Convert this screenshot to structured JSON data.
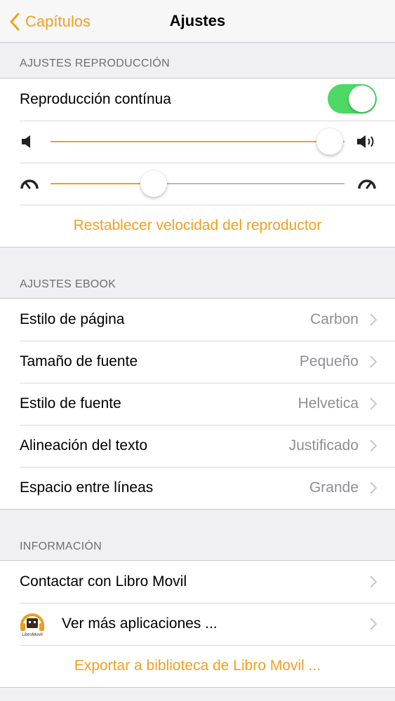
{
  "navbar": {
    "back_label": "Capítulos",
    "title": "Ajustes"
  },
  "playback": {
    "header": "AJUSTES REPRODUCCIÓN",
    "continuous_label": "Reproducción contínua",
    "continuous_on": true,
    "volume_level": 0.95,
    "speed_level": 0.35,
    "reset_label": "Restablecer velocidad del reproductor"
  },
  "ebook": {
    "header": "AJUSTES EBOOK",
    "items": [
      {
        "label": "Estilo de página",
        "value": "Carbon"
      },
      {
        "label": "Tamaño de fuente",
        "value": "Pequeño"
      },
      {
        "label": "Estilo de fuente",
        "value": "Helvetica"
      },
      {
        "label": "Alineación del texto",
        "value": "Justificado"
      },
      {
        "label": "Espacio entre líneas",
        "value": "Grande"
      }
    ]
  },
  "info": {
    "header": "INFORMACIÓN",
    "contact_label": "Contactar con Libro Movil",
    "more_apps_label": "Ver más aplicaciones ...",
    "export_label": "Exportar a biblioteca de Libro Movil ...",
    "logo_text": "LibroMovil"
  },
  "colors": {
    "accent": "#f0a020",
    "toggle_on": "#4cd964",
    "background": "#efeff4"
  }
}
